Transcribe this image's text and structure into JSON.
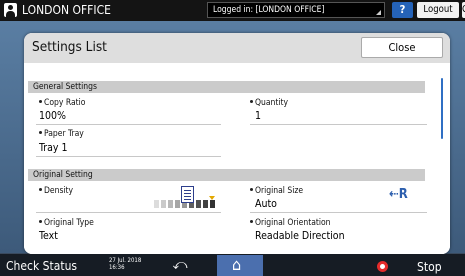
{
  "topbar": {
    "office_name": "LONDON OFFICE",
    "login_status": "Logged in: [LONDON OFFICE]",
    "help_label": "?",
    "logout_label": "Logout",
    "extra_label": "C"
  },
  "dialog": {
    "title": "Settings List",
    "close_label": "Close"
  },
  "sections": {
    "general": {
      "header": "General Settings",
      "copy_ratio": {
        "label": "Copy Ratio",
        "value": "100%"
      },
      "quantity": {
        "label": "Quantity",
        "value": "1"
      },
      "paper_tray": {
        "label": "Paper Tray",
        "value": "Tray 1"
      }
    },
    "original": {
      "header": "Original Setting",
      "density": {
        "label": "Density",
        "level": 5,
        "steps": 9
      },
      "original_size": {
        "label": "Original Size",
        "value": "Auto"
      },
      "original_type": {
        "label": "Original Type",
        "value": "Text"
      },
      "original_orientation": {
        "label": "Original Orientation",
        "value": "Readable Direction"
      }
    }
  },
  "bottombar": {
    "check_status": "Check Status",
    "date": "27 Jul. 2018",
    "time": "16:36",
    "stop_label": "Stop"
  },
  "icons": {
    "user": "user-icon",
    "back": "back-arrow-icon",
    "home": "home-icon",
    "stop": "stop-icon",
    "document": "document-icon",
    "orientation": "orientation-icon"
  },
  "colors": {
    "accent_blue": "#2563b8",
    "home_button": "#4b6fae",
    "stop_red": "#e52b2b",
    "density_marker": "#e3a800"
  }
}
